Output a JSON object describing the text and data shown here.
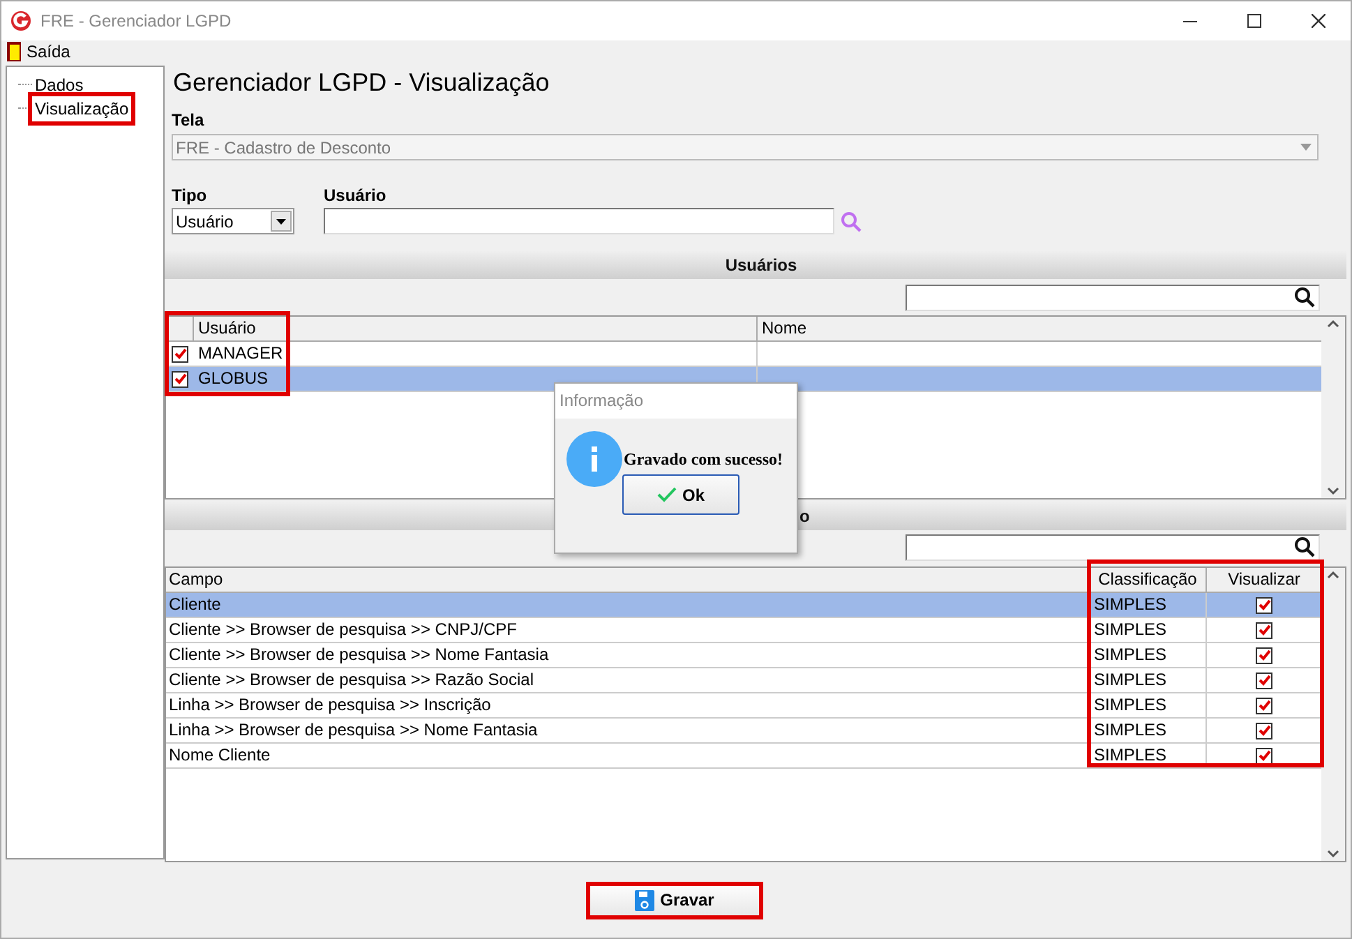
{
  "window": {
    "title": "FRE - Gerenciador LGPD"
  },
  "menu": [
    {
      "label": "Saída"
    }
  ],
  "tree": [
    {
      "label": "Dados",
      "selected": false
    },
    {
      "label": "Visualização",
      "selected": true
    }
  ],
  "heading": "Gerenciador LGPD - Visualização",
  "tela": {
    "label": "Tela",
    "value": "FRE - Cadastro de Desconto"
  },
  "tipo": {
    "label": "Tipo",
    "value": "Usuário"
  },
  "usuario": {
    "label": "Usuário"
  },
  "users_section": {
    "title": "Usuários",
    "columns": [
      "Usuário",
      "Nome"
    ],
    "rows": [
      {
        "usuario": "MANAGER",
        "checked": true,
        "selected": false
      },
      {
        "usuario": "GLOBUS",
        "checked": true,
        "selected": true
      }
    ]
  },
  "fields_section": {
    "title_visible": "o",
    "columns": [
      "Campo",
      "Classificação",
      "Visualizar"
    ],
    "rows": [
      {
        "campo": "Cliente",
        "classificacao": "SIMPLES",
        "checked": true,
        "selected": true
      },
      {
        "campo": "Cliente >> Browser de pesquisa >> CNPJ/CPF",
        "classificacao": "SIMPLES",
        "checked": true,
        "selected": false
      },
      {
        "campo": "Cliente >> Browser de pesquisa >> Nome Fantasia",
        "classificacao": "SIMPLES",
        "checked": true,
        "selected": false
      },
      {
        "campo": "Cliente >> Browser de pesquisa >> Razão Social",
        "classificacao": "SIMPLES",
        "checked": true,
        "selected": false
      },
      {
        "campo": "Linha >> Browser de pesquisa >> Inscrição",
        "classificacao": "SIMPLES",
        "checked": true,
        "selected": false
      },
      {
        "campo": "Linha >> Browser de pesquisa >> Nome Fantasia",
        "classificacao": "SIMPLES",
        "checked": true,
        "selected": false
      },
      {
        "campo": "Nome Cliente",
        "classificacao": "SIMPLES",
        "checked": true,
        "selected": false
      }
    ]
  },
  "dialog": {
    "title": "Informação",
    "message": "Gravado com sucesso!",
    "button": "Ok"
  },
  "save_button": "Gravar"
}
